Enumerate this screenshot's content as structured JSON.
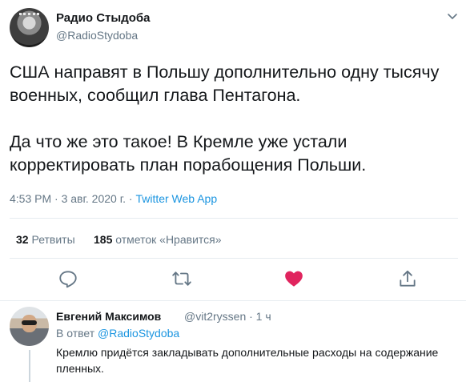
{
  "tweet": {
    "author_name": "Радио Стыдоба",
    "author_handle": "@RadioStydoba",
    "paragraph1": "США направят в Польшу дополнительно одну тысячу военных, сообщил глава Пентагона.",
    "paragraph2": "Да что же это такое! В Кремле уже устали корректировать план порабощения Польши.",
    "time": "4:53 PM · 3 авг. 2020 г.",
    "separator": "·",
    "source": "Twitter Web App",
    "retweets_count": "32",
    "retweets_label": "Ретвиты",
    "likes_count": "185",
    "likes_label": "отметок «Нравится»"
  },
  "actions": {
    "reply_icon": "reply-icon",
    "retweet_icon": "retweet-icon",
    "like_icon": "heart-icon",
    "share_icon": "share-icon",
    "liked_color": "#e0245e",
    "icon_color": "#657786"
  },
  "reply": {
    "author_name": "Евгений Максимов",
    "author_handle": "@vit2ryssen · 1 ч",
    "in_reply_prefix": "В ответ",
    "in_reply_handle": "@RadioStydoba",
    "text": "Кремлю придётся закладывать дополнительные расходы на содержание пленных."
  },
  "colors": {
    "link": "#1b95e0",
    "secondary_text": "#657786",
    "divider": "#e6ecf0"
  }
}
